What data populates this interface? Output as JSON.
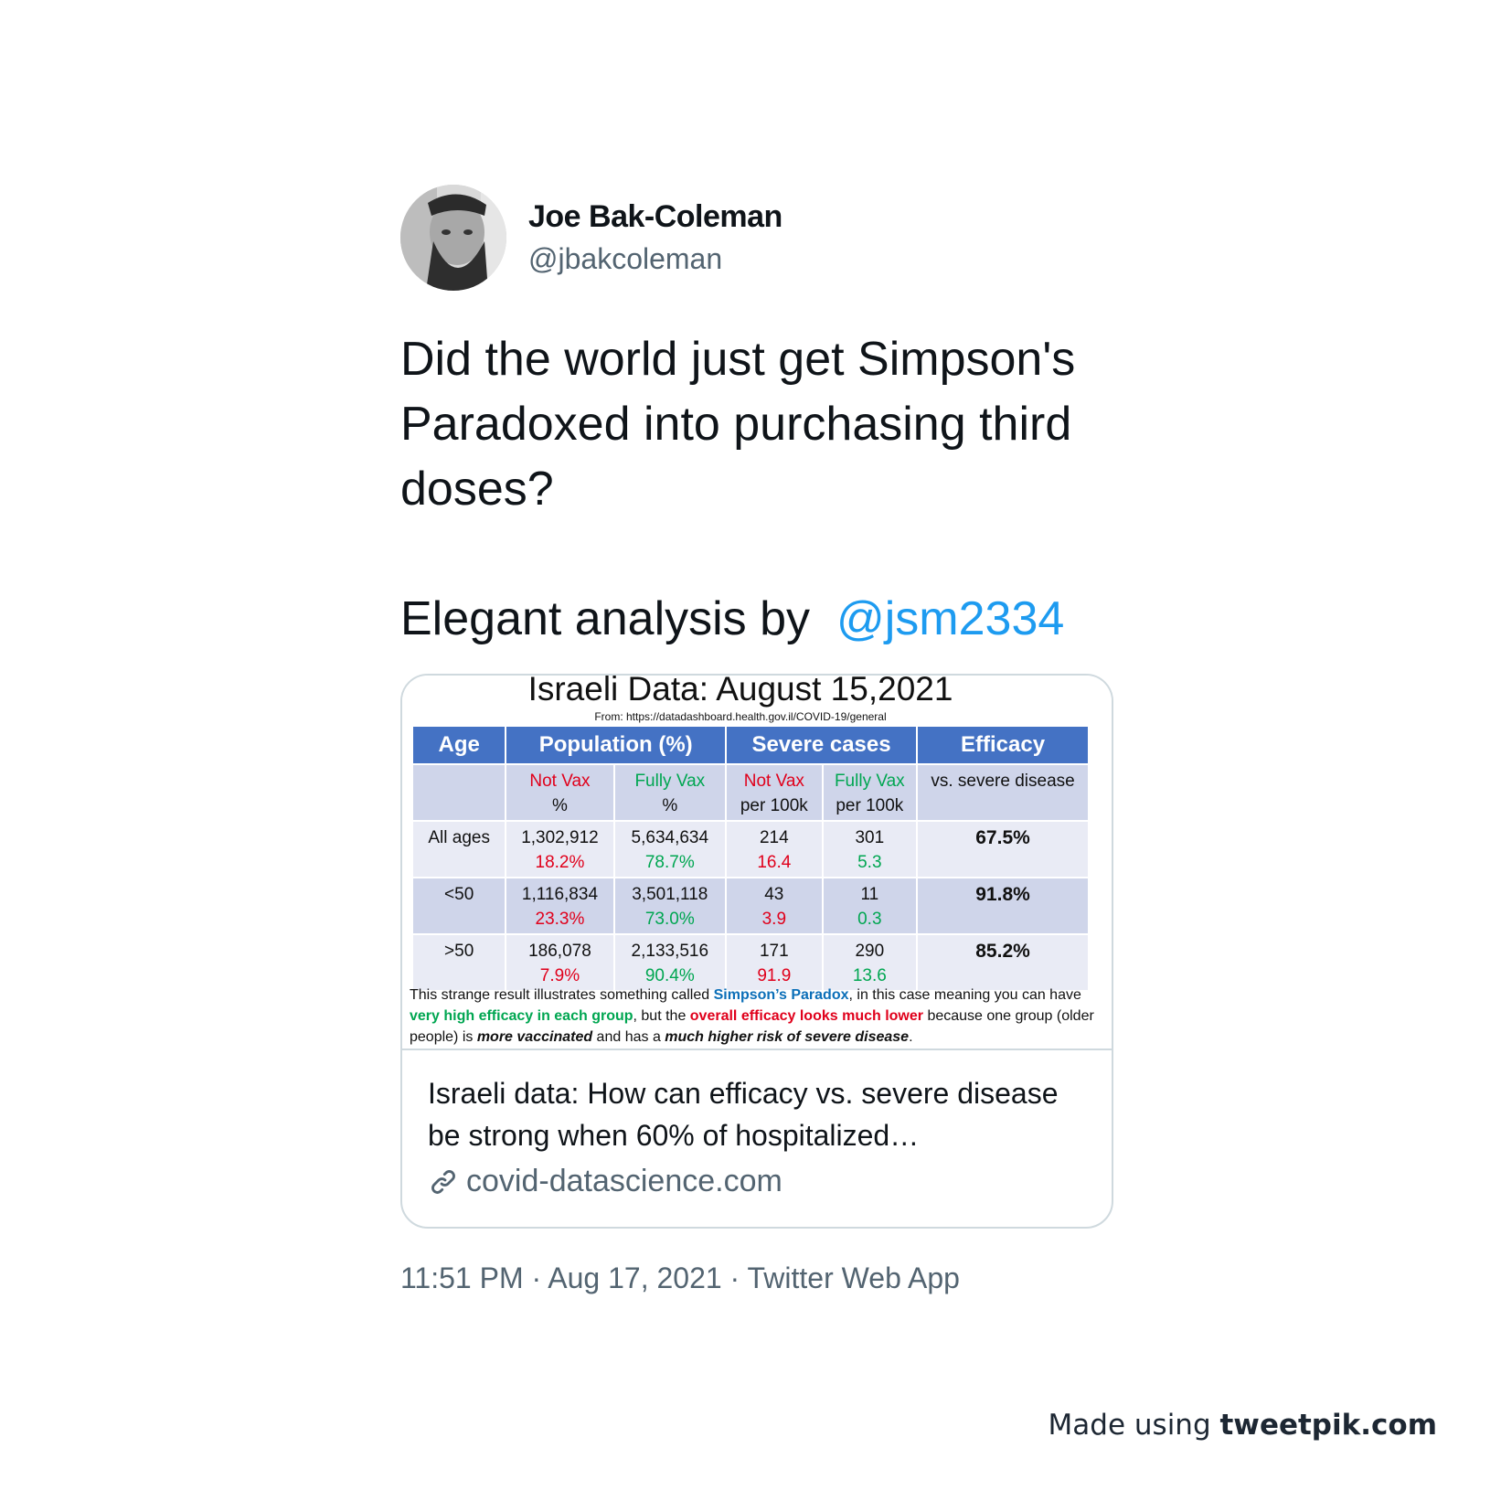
{
  "author": {
    "display_name": "Joe Bak-Coleman",
    "handle": "@jbakcoleman",
    "avatar_icon": "user-avatar-photo"
  },
  "tweet": {
    "paragraph1": "Did the world just get Simpson's Paradoxed into purchasing third doses?",
    "paragraph2_prefix": "Elegant analysis by ",
    "mention": "@jsm2334"
  },
  "card": {
    "image": {
      "title": "Israeli Data: August 15,2021",
      "source": "From: https://datadashboard.health.gov.il/COVID-19/general",
      "headers": [
        "Age",
        "Population (%)",
        "Severe cases",
        "Efficacy"
      ],
      "subheaders": {
        "not_vax_pop": "Not Vax",
        "not_vax_pop_unit": "%",
        "fully_vax_pop": "Fully Vax",
        "fully_vax_pop_unit": "%",
        "not_vax_severe": "Not Vax",
        "not_vax_severe_unit": "per 100k",
        "fully_vax_severe": "Fully Vax",
        "fully_vax_severe_unit": "per 100k",
        "efficacy_desc": "vs. severe disease"
      },
      "rows": [
        {
          "age": "All ages",
          "not_vax": "1,302,912",
          "not_vax_pct": "18.2%",
          "fully_vax": "5,634,634",
          "fully_vax_pct": "78.7%",
          "severe_not_vax": "214",
          "severe_not_vax_rate": "16.4",
          "severe_fully_vax": "301",
          "severe_fully_vax_rate": "5.3",
          "efficacy": "67.5%"
        },
        {
          "age": "<50",
          "not_vax": "1,116,834",
          "not_vax_pct": "23.3%",
          "fully_vax": "3,501,118",
          "fully_vax_pct": "73.0%",
          "severe_not_vax": "43",
          "severe_not_vax_rate": "3.9",
          "severe_fully_vax": "11",
          "severe_fully_vax_rate": "0.3",
          "efficacy": "91.8%"
        },
        {
          "age": ">50",
          "not_vax": "186,078",
          "not_vax_pct": "7.9%",
          "fully_vax": "2,133,516",
          "fully_vax_pct": "90.4%",
          "severe_not_vax": "171",
          "severe_not_vax_rate": "91.9",
          "severe_fully_vax": "290",
          "severe_fully_vax_rate": "13.6",
          "efficacy": "85.2%"
        }
      ],
      "note": {
        "p1": "This strange result illustrates something called ",
        "simpsons": "Simpson’s Paradox",
        "p2": ", in this case meaning you can have ",
        "high_efficacy": "very high efficacy in each group",
        "p3": ", but the ",
        "overall_low": "overall efficacy looks much lower",
        "p4": " because one group (older people) is ",
        "more_vax": "more vaccinated",
        "p5": " and has a ",
        "higher_risk": "much higher risk of severe disease",
        "p6": "."
      },
      "colors": {
        "header_blue": "#4472c4",
        "red": "#e0001b",
        "green": "#00a651",
        "link_blue": "#0b6fb8"
      }
    },
    "title": "Israeli data: How can efficacy vs. severe disease be strong when 60% of hospitalized…",
    "domain": "covid-datascience.com",
    "domain_icon": "link-icon"
  },
  "meta": {
    "time": "11:51 PM",
    "date": "Aug 17, 2021",
    "source": "Twitter Web App",
    "separator": " · "
  },
  "watermark": {
    "prefix": "Made using ",
    "brand": "tweetpik.com"
  },
  "colors": {
    "mention": "#1d9bf0",
    "secondary_text": "#536471",
    "border": "#cfd9de"
  }
}
